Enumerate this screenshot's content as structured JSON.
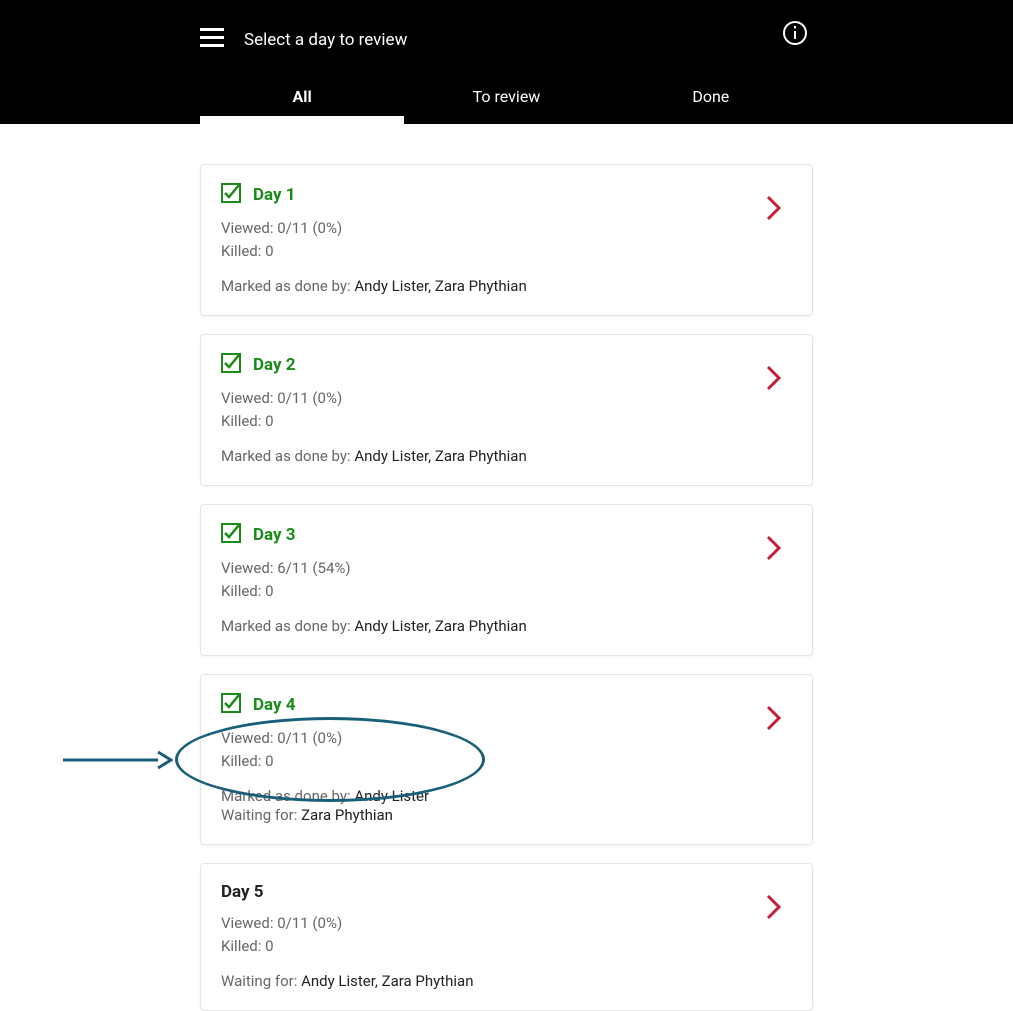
{
  "header": {
    "title": "Select a day to review"
  },
  "tabs": {
    "all": "All",
    "toReview": "To review",
    "done": "Done"
  },
  "days": [
    {
      "title": "Day 1",
      "done": true,
      "viewed": "Viewed: 0/11 (0%)",
      "killed": "Killed: 0",
      "markedLabel": "Marked as done by: ",
      "markedNames": "Andy Lister, Zara Phythian",
      "waitingLabel": "",
      "waitingNames": ""
    },
    {
      "title": "Day 2",
      "done": true,
      "viewed": "Viewed: 0/11 (0%)",
      "killed": "Killed: 0",
      "markedLabel": "Marked as done by: ",
      "markedNames": "Andy Lister, Zara Phythian",
      "waitingLabel": "",
      "waitingNames": ""
    },
    {
      "title": "Day 3",
      "done": true,
      "viewed": "Viewed: 6/11 (54%)",
      "killed": "Killed: 0",
      "markedLabel": "Marked as done by: ",
      "markedNames": "Andy Lister, Zara Phythian",
      "waitingLabel": "",
      "waitingNames": ""
    },
    {
      "title": "Day 4",
      "done": true,
      "viewed": "Viewed: 0/11 (0%)",
      "killed": "Killed: 0",
      "markedLabel": "Marked as done by: ",
      "markedNames": "Andy Lister",
      "waitingLabel": "Waiting for: ",
      "waitingNames": "Zara Phythian"
    },
    {
      "title": "Day 5",
      "done": false,
      "viewed": "Viewed: 0/11 (0%)",
      "killed": "Killed: 0",
      "markedLabel": "",
      "markedNames": "",
      "waitingLabel": "Waiting for: ",
      "waitingNames": "Andy Lister, Zara Phythian"
    }
  ]
}
